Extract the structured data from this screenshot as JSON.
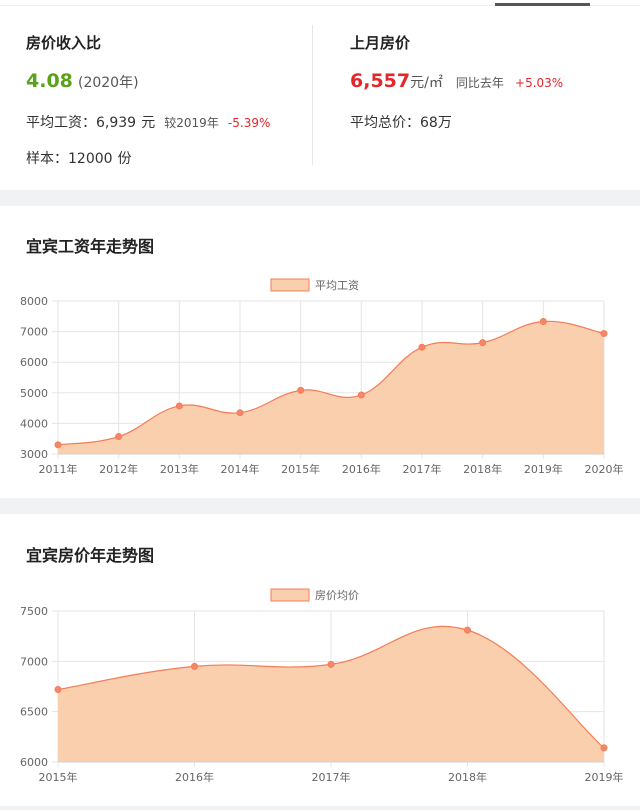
{
  "summary": {
    "left": {
      "title": "房价收入比",
      "ratio_value": "4.08",
      "ratio_year": "(2020年)",
      "salary_label": "平均工资：",
      "salary_value": "6,939",
      "salary_unit": "元",
      "salary_compare_label": "较2019年",
      "salary_change": "-5.39%",
      "sample_label": "样本：",
      "sample_value": "12000",
      "sample_unit": "份"
    },
    "right": {
      "title": "上月房价",
      "price_value": "6,557",
      "price_unit": "元/㎡",
      "yoy_label": "同比去年",
      "yoy_change": "+5.03%",
      "total_label": "平均总价：",
      "total_value": "68万"
    }
  },
  "sections": {
    "salary_title": "宜宾工资年走势图",
    "price_title": "宜宾房价年走势图"
  },
  "colors": {
    "fill": "#f9cfad",
    "line": "#f47c56",
    "point": "#f4866a",
    "green": "#5aa219",
    "red": "#e2262a"
  },
  "chart_data": [
    {
      "type": "area",
      "title": "",
      "legend": [
        "平均工资"
      ],
      "legend_position": "top-center",
      "x": [
        "2011年",
        "2012年",
        "2013年",
        "2014年",
        "2015年",
        "2016年",
        "2017年",
        "2018年",
        "2019年",
        "2020年"
      ],
      "series": [
        {
          "name": "平均工资",
          "values": [
            3300,
            3570,
            4570,
            4350,
            5080,
            4930,
            6490,
            6640,
            7330,
            6939
          ]
        }
      ],
      "ylim": [
        3000,
        8000
      ],
      "yticks": [
        3000,
        4000,
        5000,
        6000,
        7000,
        8000
      ],
      "grid": true,
      "xlabel": "",
      "ylabel": ""
    },
    {
      "type": "area",
      "title": "",
      "legend": [
        "房价均价"
      ],
      "legend_position": "top-center",
      "x": [
        "2015年",
        "2016年",
        "2017年",
        "2018年",
        "2019年"
      ],
      "series": [
        {
          "name": "房价均价",
          "values": [
            6720,
            6950,
            6970,
            7310,
            6140
          ]
        }
      ],
      "ylim": [
        6000,
        7500
      ],
      "yticks": [
        6000,
        6500,
        7000,
        7500
      ],
      "grid": true,
      "xlabel": "",
      "ylabel": ""
    }
  ]
}
